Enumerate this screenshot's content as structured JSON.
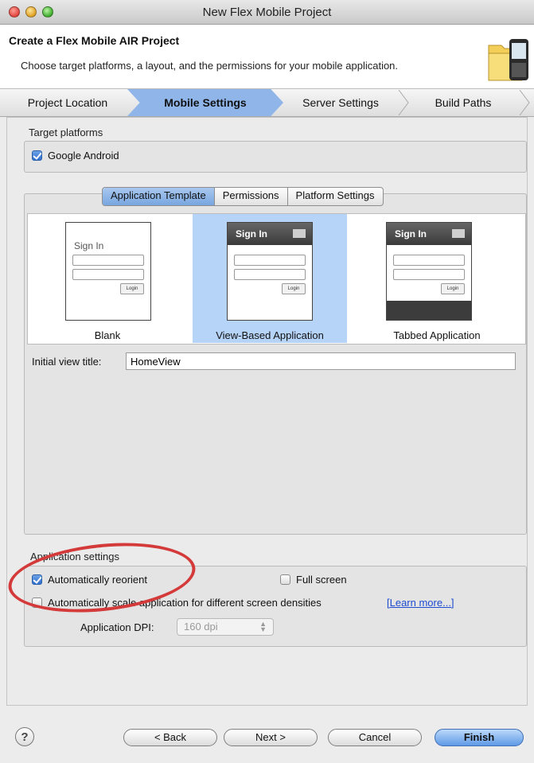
{
  "window": {
    "title": "New Flex Mobile Project"
  },
  "header": {
    "title": "Create a Flex Mobile AIR Project",
    "description": "Choose target platforms, a layout, and the permissions for your mobile application."
  },
  "wizard_steps": [
    "Project Location",
    "Mobile Settings",
    "Server Settings",
    "Build Paths"
  ],
  "target_platforms": {
    "label": "Target platforms",
    "google_android": {
      "label": "Google Android",
      "checked": true
    }
  },
  "tabs": [
    "Application Template",
    "Permissions",
    "Platform Settings"
  ],
  "templates": {
    "blank": {
      "label": "Blank",
      "sign_in": "Sign In",
      "login": "Login"
    },
    "view_based": {
      "label": "View-Based Application",
      "sign_in": "Sign In",
      "login": "Login"
    },
    "tabbed": {
      "label": "Tabbed Application",
      "sign_in": "Sign In",
      "login": "Login"
    }
  },
  "initial_view": {
    "label": "Initial view title:",
    "value": "HomeView"
  },
  "app_settings": {
    "label": "Application settings",
    "auto_reorient": {
      "label": "Automatically reorient",
      "checked": true
    },
    "full_screen": {
      "label": "Full screen",
      "checked": false
    },
    "auto_scale": {
      "label": "Automatically scale application for different screen densities",
      "checked": false
    },
    "learn_more": "[Learn more...]",
    "dpi_label": "Application DPI:",
    "dpi_value": "160 dpi"
  },
  "buttons": {
    "back": "< Back",
    "next": "Next >",
    "cancel": "Cancel",
    "finish": "Finish",
    "help": "?"
  },
  "colors": {
    "selection": "#b6d3f8",
    "step_active": "#8fb5e9",
    "finish": "#5f9ae7",
    "annotation": "#d43a3a"
  }
}
